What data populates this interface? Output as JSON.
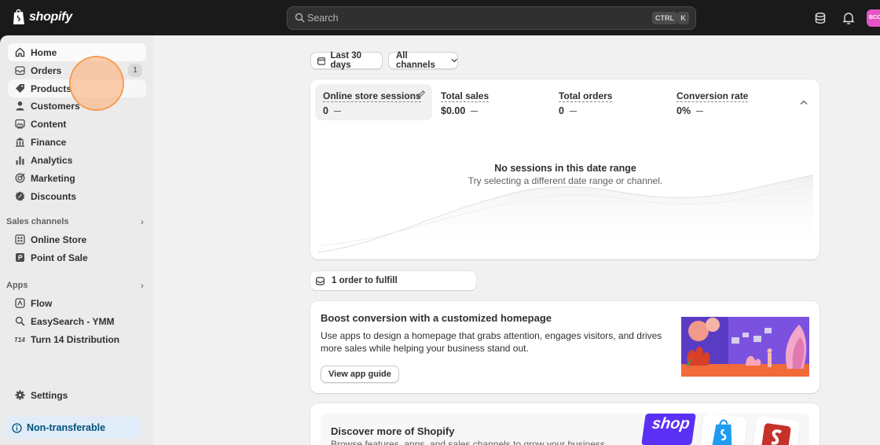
{
  "topbar": {
    "logo_text": "shopify",
    "search_placeholder": "Search",
    "shortcut_ctrl": "CTRL",
    "shortcut_key": "K",
    "avatar_initials": "BCC"
  },
  "sidebar": {
    "items": [
      {
        "label": "Home",
        "icon": "home-icon"
      },
      {
        "label": "Orders",
        "icon": "orders-icon",
        "badge": "1"
      },
      {
        "label": "Products",
        "icon": "tag-icon"
      },
      {
        "label": "Customers",
        "icon": "person-icon"
      },
      {
        "label": "Content",
        "icon": "image-icon"
      },
      {
        "label": "Finance",
        "icon": "bank-icon"
      },
      {
        "label": "Analytics",
        "icon": "bar-chart-icon"
      },
      {
        "label": "Marketing",
        "icon": "target-icon"
      },
      {
        "label": "Discounts",
        "icon": "discount-icon"
      }
    ],
    "sales_channels": {
      "label": "Sales channels",
      "items": [
        {
          "label": "Online Store",
          "icon": "storefront-icon"
        },
        {
          "label": "Point of Sale",
          "icon": "pos-icon"
        }
      ]
    },
    "apps": {
      "label": "Apps",
      "items": [
        {
          "label": "Flow",
          "icon": "flow-icon"
        },
        {
          "label": "EasySearch - YMM",
          "icon": "search-icon"
        },
        {
          "label": "Turn 14 Distribution",
          "icon": "t14-icon"
        }
      ]
    },
    "settings_label": "Settings",
    "non_transferable_label": "Non-transferable"
  },
  "filters": {
    "date_range": "Last 30 days",
    "channels": "All channels"
  },
  "metrics": [
    {
      "title": "Online store sessions",
      "value": "0"
    },
    {
      "title": "Total sales",
      "value": "$0.00"
    },
    {
      "title": "Total orders",
      "value": "0"
    },
    {
      "title": "Conversion rate",
      "value": "0%"
    }
  ],
  "empty_state": {
    "title": "No sessions in this date range",
    "subtitle": "Try selecting a different date range or channel."
  },
  "fulfill": {
    "label": "1 order to fulfill"
  },
  "boost_card": {
    "title": "Boost conversion with a customized homepage",
    "body": "Use apps to design a homepage that grabs attention, engages visitors, and drives more sales while helping your business stand out.",
    "button": "View app guide"
  },
  "discover_card": {
    "title": "Discover more of Shopify",
    "body": "Browse features, apps, and sales channels to grow your business",
    "shop_logo_text": "shop"
  },
  "colors": {
    "topbar": "#1a1a1a",
    "sidebar": "#ebebeb",
    "main_bg": "#f1f1f1",
    "accent_blue": "#00527c",
    "avatar": "#e655c8"
  }
}
